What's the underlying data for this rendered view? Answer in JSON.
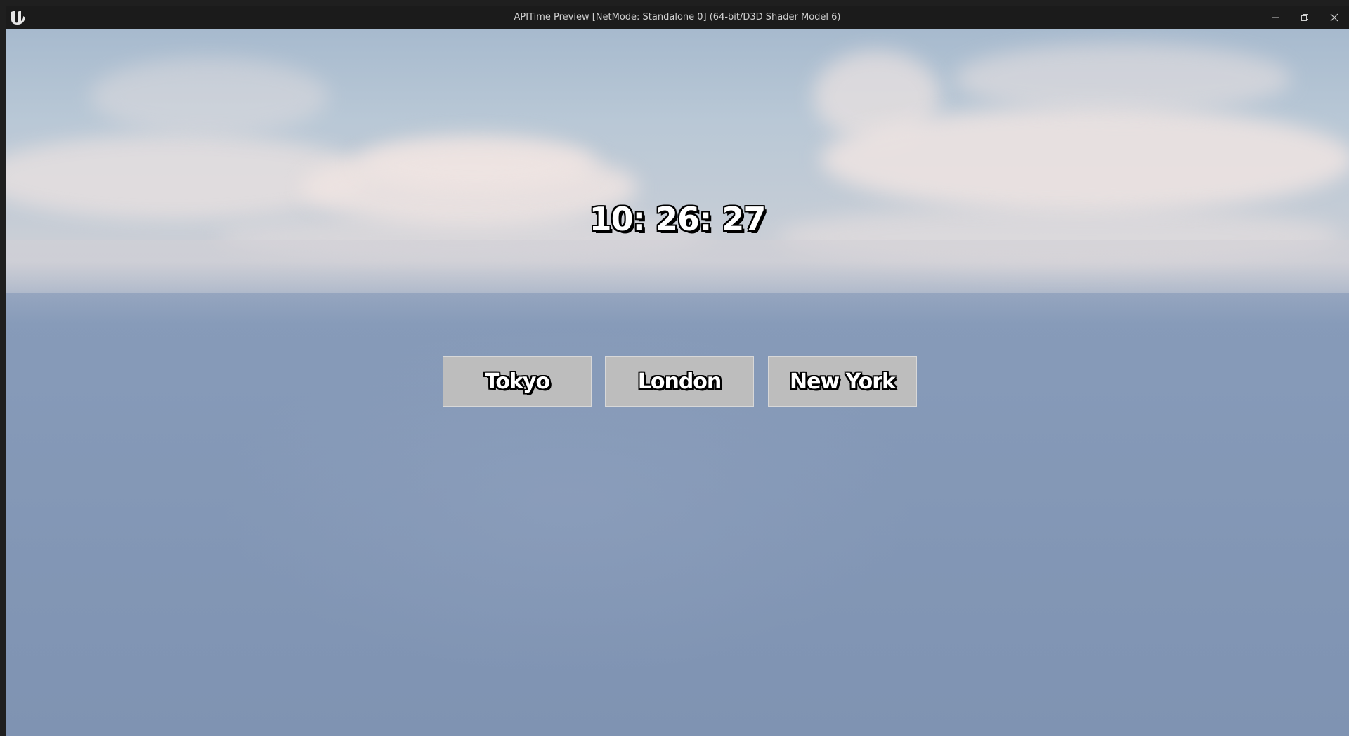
{
  "window": {
    "title": "APITime Preview [NetMode: Standalone 0]  (64-bit/D3D Shader Model 6)",
    "icons": {
      "logo": "unreal-engine-logo",
      "minimize": "minimize-icon",
      "restore": "restore-icon",
      "close": "close-icon"
    }
  },
  "clock": {
    "time": "10: 26: 27"
  },
  "cities": [
    {
      "label": "Tokyo"
    },
    {
      "label": "London"
    },
    {
      "label": "New York"
    }
  ],
  "colors": {
    "titlebar": "#1b1b1b",
    "sky_top": "#a7bace",
    "ground": "#879bb9",
    "button_bg": "#bdbdbd",
    "text_fill": "#ffffff",
    "text_outline": "#000000"
  }
}
